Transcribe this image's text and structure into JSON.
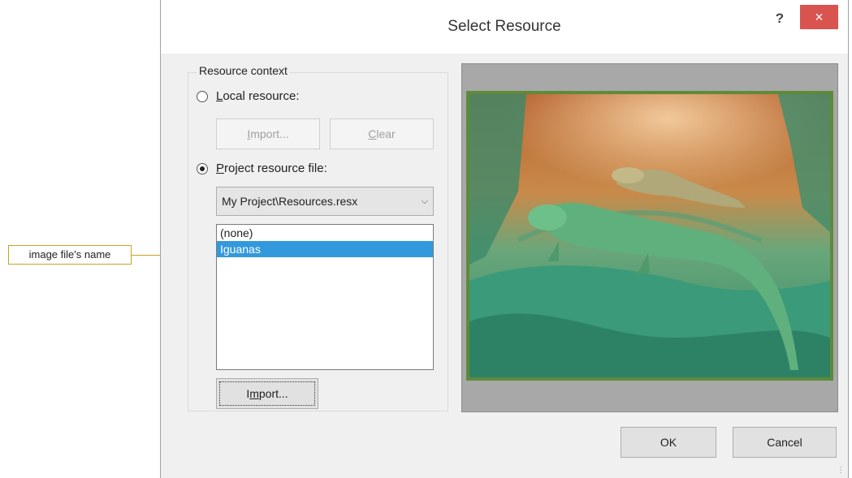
{
  "callout": {
    "label": "image file's name"
  },
  "dialog": {
    "title": "Select Resource",
    "help_label": "?",
    "close_label": "×"
  },
  "resource_context": {
    "group_label": "Resource context",
    "local_resource": {
      "label_mnemonic": "L",
      "label_rest": "ocal resource:",
      "checked": false,
      "import_mnemonic": "I",
      "import_rest": "mport...",
      "clear_mnemonic": "C",
      "clear_rest": "lear"
    },
    "project_resource": {
      "label_mnemonic": "P",
      "label_rest": "roject resource file:",
      "checked": true,
      "file_select_value": "My Project\\Resources.resx",
      "items": [
        "(none)",
        "Iguanas"
      ],
      "selected_item": "Iguanas",
      "import_pre": "I",
      "import_mnemonic": "m",
      "import_rest": "port..."
    }
  },
  "preview": {
    "image_name": "iguana-photo"
  },
  "footer": {
    "ok_label": "OK",
    "cancel_label": "Cancel"
  },
  "colors": {
    "close_button": "#d9534f",
    "selection": "#3399dd",
    "callout_border": "#c9a227",
    "image_border": "#5e8a3a"
  }
}
